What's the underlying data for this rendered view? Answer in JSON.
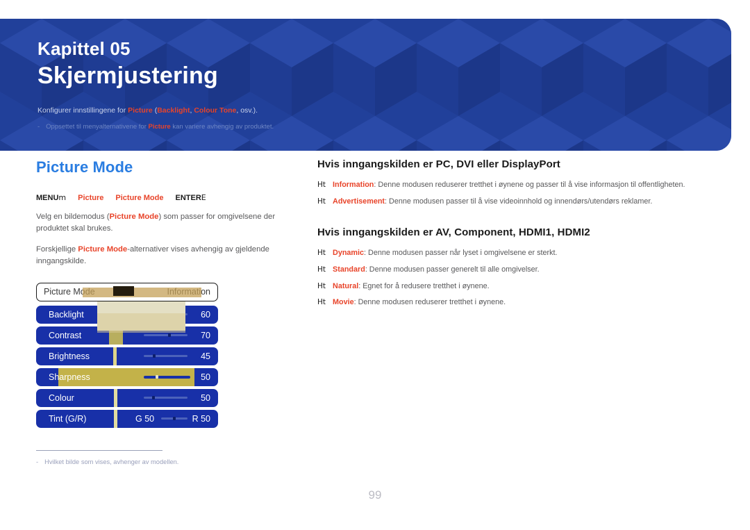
{
  "banner": {
    "chapter_label": "Kapittel 05",
    "chapter_title": "Skjermjustering",
    "desc_prefix": "Konfigurer innstillingene for ",
    "desc_hl1": "Picture",
    "desc_mid": " (",
    "desc_hl2": "Backlight",
    "desc_mid2": ", ",
    "desc_hl3": "Colour Tone",
    "desc_suffix": ", osv.).",
    "note_dash": "-",
    "note_prefix": "Oppsettet til menyalternativene for ",
    "note_hl": "Picture",
    "note_suffix": " kan variere avhengig av produktet.",
    "bg_color": "#21409a",
    "accent_color": "#e8442a"
  },
  "left": {
    "section_title": "Picture Mode",
    "menu_path": {
      "menu_label": "MENU",
      "menu_sym": "m",
      "seg1": "Picture",
      "seg2": "Picture Mode",
      "enter_label": "ENTER",
      "enter_sym": "E"
    },
    "paragraph1_a": "Velg en bildemodus (",
    "paragraph1_b": "Picture Mode",
    "paragraph1_c": ") som passer for omgivelsene der produktet skal brukes.",
    "paragraph2_a": "Forskjellige ",
    "paragraph2_b": "Picture Mode",
    "paragraph2_c": "-alternativer vises avhengig av gjeldende inngangskilde.",
    "osd": {
      "header": {
        "left_label": "Picture Mode",
        "right_label": "Information"
      },
      "rows": [
        {
          "label": "Backlight",
          "value": "60",
          "highlight": false
        },
        {
          "label": "Contrast",
          "value": "70",
          "highlight": false
        },
        {
          "label": "Brightness",
          "value": "45",
          "highlight": false
        },
        {
          "label": "Sharpness",
          "value": "50",
          "highlight": true
        },
        {
          "label": "Colour",
          "value": "50",
          "highlight": false
        },
        {
          "label": "Tint (G/R)",
          "value": "R 50",
          "value_left": "G 50",
          "highlight": false
        }
      ],
      "colors": {
        "row_blue": "#1830a8",
        "highlight_gold": "#c3b249",
        "beige": "#e4dfc4"
      }
    },
    "footnote": {
      "dash": "-",
      "text": "Hvilket bilde som vises, avhenger av modellen."
    }
  },
  "right": {
    "heading1": "Hvis inngangskilden er PC, DVI eller DisplayPort",
    "list1": [
      {
        "glyph": "Ht",
        "term": "Information",
        "text": ": Denne modusen reduserer tretthet i øynene og passer til å vise informasjon til offentligheten."
      },
      {
        "glyph": "Ht",
        "term": "Advertisement",
        "text": ": Denne modusen passer til å vise videoinnhold og innendørs/utendørs reklamer."
      }
    ],
    "heading2": "Hvis inngangskilden er AV, Component, HDMI1, HDMI2",
    "list2": [
      {
        "glyph": "Ht",
        "term": "Dynamic",
        "text": ": Denne modusen passer når lyset i omgivelsene er sterkt."
      },
      {
        "glyph": "Ht",
        "term": "Standard",
        "text": ": Denne modusen passer generelt til alle omgivelser."
      },
      {
        "glyph": "Ht",
        "term": "Natural",
        "text": ": Egnet for å redusere tretthet i øynene."
      },
      {
        "glyph": "Ht",
        "term": "Movie",
        "text": ": Denne modusen reduserer tretthet i øynene."
      }
    ]
  },
  "page_number": "99"
}
